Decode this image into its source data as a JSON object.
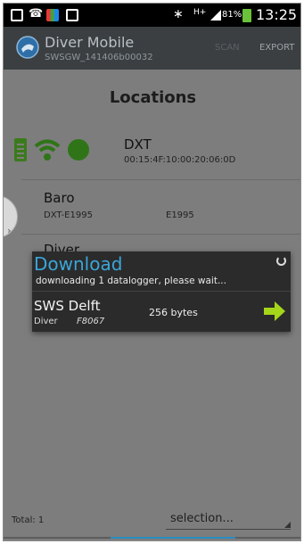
{
  "status_bar": {
    "battery_percent": "81%",
    "time": "13:25",
    "network_label": "H+"
  },
  "action_bar": {
    "title": "Diver Mobile",
    "subtitle": "SWSGW_141406b00032",
    "scan_label": "SCAN",
    "export_label": "EXPORT"
  },
  "locations": {
    "title": "Locations",
    "items": [
      {
        "name": "DXT",
        "detail": "00:15:4F:10:00:20:06:0D"
      },
      {
        "name": "Baro",
        "detail": "DXT-E1995",
        "code": "E1995"
      },
      {
        "name": "Diver"
      }
    ]
  },
  "footer": {
    "total": "Total: 1",
    "selection": "selection..."
  },
  "dialog": {
    "title": "Download",
    "message": "downloading 1 datalogger, please wait...",
    "device_name": "SWS Delft",
    "device_type": "Diver",
    "device_serial": "F8067",
    "bytes": "256 bytes"
  },
  "colors": {
    "accent_blue": "#3aa6d9",
    "status_green": "#2f7518",
    "arrow_green": "#a6d61a",
    "action_bar": "#3b3f42"
  },
  "icons": {
    "wifi": "wifi-icon",
    "battery": "battery-icon",
    "connected": "status-dot-icon",
    "next": "arrow-right-icon",
    "app": "diver-logo-icon"
  }
}
